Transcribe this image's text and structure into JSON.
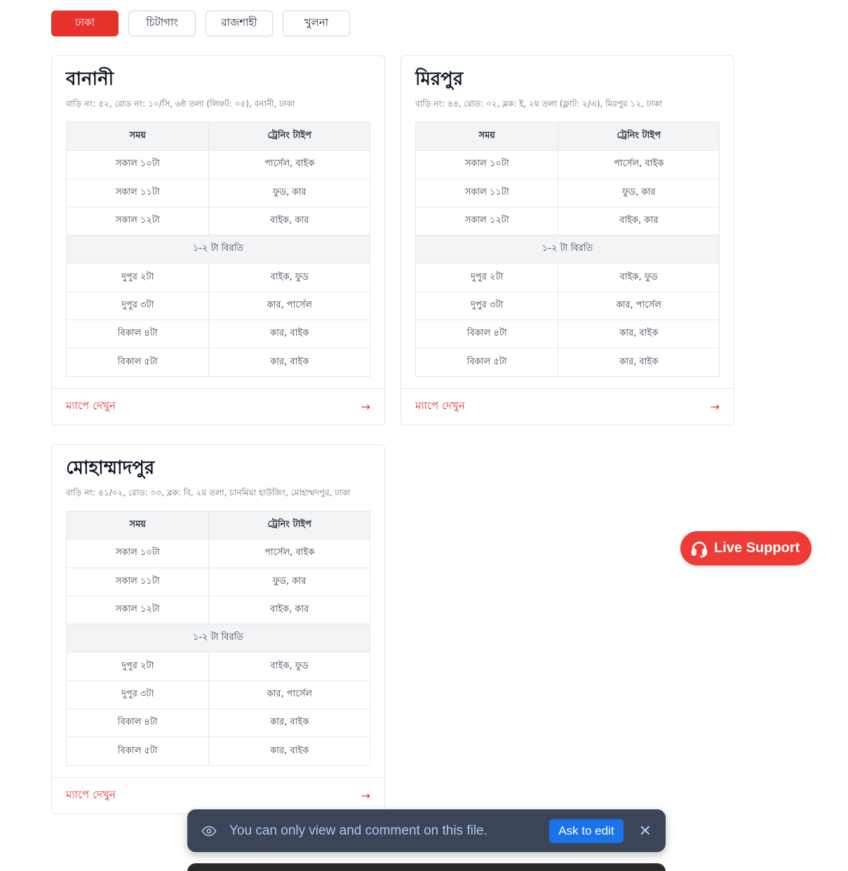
{
  "tabs": [
    {
      "label": "ঢাকা",
      "active": true
    },
    {
      "label": "চিটাগাং",
      "active": false
    },
    {
      "label": "রাজশাহী",
      "active": false
    },
    {
      "label": "খুলনা",
      "active": false
    }
  ],
  "table_headers": {
    "time": "সময়",
    "type": "ট্রেনিং টাইপ"
  },
  "schedule": [
    {
      "time": "সকাল ১০টা",
      "type": "পার্সেল, বাইক"
    },
    {
      "time": "সকাল ১১টা",
      "type": "ফুড, কার"
    },
    {
      "time": "সকাল ১২টা",
      "type": "বাইক, কার"
    },
    {
      "break": "১-২ টা বিরতি"
    },
    {
      "time": "দুপুর ২টা",
      "type": "বাইক, ফুড"
    },
    {
      "time": "দুপুর ৩টা",
      "type": "কার, পার্সেল"
    },
    {
      "time": "বিকাল ৪টা",
      "type": "কার, বাইক"
    },
    {
      "time": "বিকাল ৫টা",
      "type": "কার, বাইক"
    }
  ],
  "branches": [
    {
      "name": "বানানী",
      "address": "বাড়ি নং: ৫২, রোড নং: ১০/সি, ৬ষ্ঠ তলা (লিফট: ০৫), বনানী, ঢাকা"
    },
    {
      "name": "মিরপুর",
      "address": "বাড়ি নং: ৪৪, রোড: ০২, ব্লক: ই, ২য় তলা (ফ্লাট: ২/এ), মিরপুর ১২, ঢাকা"
    },
    {
      "name": "মোহাম্মাদপুর",
      "address": "বাড়ি নং: ৪১/০২, রোড: ০৩, ব্লক: বি, ২য় তলা, চানমিয়া হাউজিং, মোহাম্মদপুর, ঢাকা"
    }
  ],
  "map_link_label": "ম্যাপে দেখুন",
  "arrow_glyph": "→",
  "live_support": {
    "label": "Live Support"
  },
  "toast": {
    "message": "You can only view and comment on this file.",
    "ask_label": "Ask to edit",
    "close_glyph": "✕"
  },
  "colors": {
    "accent": "#e5322d",
    "toast_bg": "#3b4557",
    "ask_btn": "#1a73e8"
  }
}
